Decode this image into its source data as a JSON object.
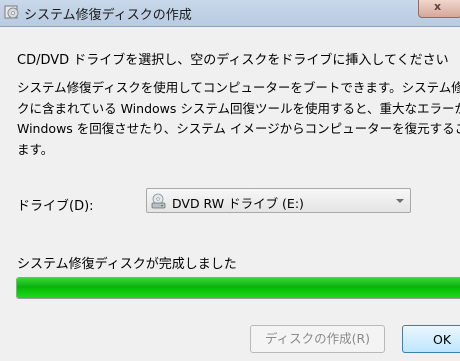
{
  "window": {
    "title": "システム修復ディスクの作成",
    "close_glyph": "x"
  },
  "dialog": {
    "instruction": "CD/DVD ドライブを選択し、空のディスクをドライブに挿入してください",
    "description_lines": [
      "システム修復ディスクを使用してコンピューターをブートできます。システム修復",
      "クに含まれている Windows システム回復ツールを使用すると、重大なエラーから",
      "Windows を回復させたり、システム イメージからコンピューターを復元すること",
      "ます。"
    ],
    "drive_label": "ドライブ(D):",
    "drive_selected": "DVD RW ドライブ (E:)",
    "status": "システム修復ディスクが完成しました",
    "progress_fraction": 1.0,
    "progress_color": "#0db00d",
    "buttons": {
      "create": "ディスクの作成(R)",
      "ok": "OK"
    }
  }
}
